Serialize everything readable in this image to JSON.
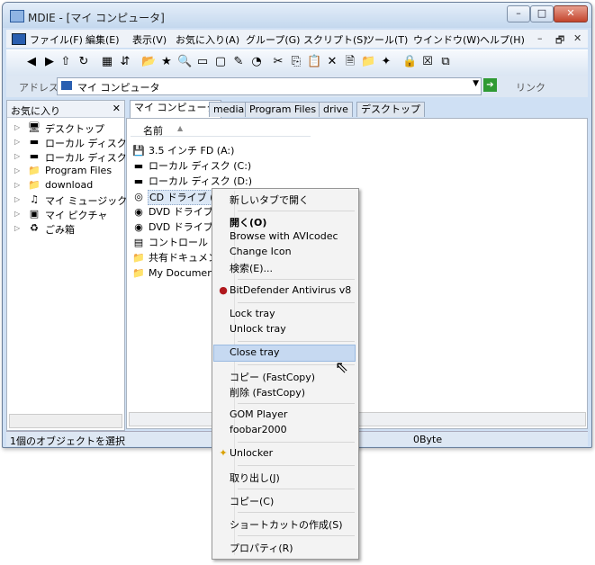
{
  "window": {
    "title": "MDIE - [マイ コンピュータ]",
    "controls": {
      "minimize": "–",
      "maximize": "□",
      "close": "✕"
    }
  },
  "menubar": {
    "items": [
      "ファイル(F)",
      "編集(E)",
      "表示(V)",
      "お気に入り(A)",
      "グループ(G)",
      "スクリプト(S)",
      "ツール(T)",
      "ウインドウ(W)",
      "ヘルプ(H)"
    ],
    "mdi_controls": {
      "minimize": "–",
      "restore": "🗗",
      "close": "✕"
    }
  },
  "toolbar": {
    "buttons": [
      {
        "name": "back",
        "glyph": "◀"
      },
      {
        "name": "forward",
        "glyph": "▶"
      },
      {
        "name": "up",
        "glyph": "⇧"
      },
      {
        "name": "refresh",
        "glyph": "↻"
      },
      {
        "name": "views",
        "glyph": "▦"
      },
      {
        "name": "sort",
        "glyph": "⇵"
      },
      {
        "name": "folder",
        "glyph": "📂"
      },
      {
        "name": "favorite",
        "glyph": "★"
      },
      {
        "name": "search",
        "glyph": "🔍"
      },
      {
        "name": "screen",
        "glyph": "▭"
      },
      {
        "name": "window",
        "glyph": "▢"
      },
      {
        "name": "edit",
        "glyph": "✎"
      },
      {
        "name": "history",
        "glyph": "◔"
      },
      {
        "name": "cut",
        "glyph": "✂"
      },
      {
        "name": "copy",
        "glyph": "⎘"
      },
      {
        "name": "paste",
        "glyph": "📋"
      },
      {
        "name": "delete",
        "glyph": "✕"
      },
      {
        "name": "properties",
        "glyph": "🗎"
      },
      {
        "name": "newfolder",
        "glyph": "📁"
      },
      {
        "name": "star",
        "glyph": "✦"
      },
      {
        "name": "lock",
        "glyph": "🔒"
      },
      {
        "name": "close-tab",
        "glyph": "☒"
      },
      {
        "name": "close-all",
        "glyph": "⧉"
      }
    ]
  },
  "addressbar": {
    "label": "アドレス",
    "value": "マイ コンピュータ",
    "links_label": "リンク"
  },
  "favorites": {
    "title": "お気に入り",
    "close": "✕",
    "items": [
      {
        "label": "デスクトップ",
        "icon": "desktop-icon",
        "glyph": "🖥"
      },
      {
        "label": "ローカル ディスク(",
        "icon": "drive-icon",
        "glyph": "▬"
      },
      {
        "label": "ローカル ディスク(",
        "icon": "drive-icon",
        "glyph": "▬"
      },
      {
        "label": "Program Files",
        "icon": "folder-icon",
        "glyph": "📁"
      },
      {
        "label": "download",
        "icon": "folder-icon",
        "glyph": "📁"
      },
      {
        "label": "マイ ミュージック",
        "icon": "music-folder-icon",
        "glyph": "♫"
      },
      {
        "label": "マイ ピクチャ",
        "icon": "pictures-folder-icon",
        "glyph": "▣"
      },
      {
        "label": "ごみ箱",
        "icon": "recycle-bin-icon",
        "glyph": "♻"
      }
    ]
  },
  "tabs": [
    "マイ コンピュータ",
    "media",
    "Program Files",
    "drive",
    "デスクトップ"
  ],
  "listview": {
    "column": "名前",
    "items": [
      {
        "label": "3.5 インチ FD (A:)",
        "icon": "floppy-icon",
        "glyph": "💾"
      },
      {
        "label": "ローカル ディスク (C:)",
        "icon": "drive-icon",
        "glyph": "▬"
      },
      {
        "label": "ローカル ディスク (D:)",
        "icon": "drive-icon",
        "glyph": "▬"
      },
      {
        "label": "CD ドライブ (E:",
        "icon": "cd-drive-icon",
        "glyph": "◎"
      },
      {
        "label": "DVD ドライブ (C",
        "icon": "dvd-drive-icon",
        "glyph": "◉"
      },
      {
        "label": "DVD ドライブ (H",
        "icon": "dvd-drive-icon",
        "glyph": "◉"
      },
      {
        "label": "コントロール パ",
        "icon": "control-panel-icon",
        "glyph": "▤"
      },
      {
        "label": "共有ドキュメン",
        "icon": "folder-icon",
        "glyph": "📁"
      },
      {
        "label": "My Documents",
        "icon": "folder-icon",
        "glyph": "📁"
      }
    ]
  },
  "context_menu": {
    "items": [
      "新しいタブで開く",
      "開く(O)",
      "Browse with AVIcodec",
      "Change Icon",
      "検索(E)...",
      "BitDefender Antivirus v8",
      "Lock tray",
      "Unlock tray",
      "Close tray",
      "コピー (FastCopy)",
      "削除 (FastCopy)",
      "GOM Player",
      "foobar2000",
      "Unlocker",
      "取り出し(J)",
      "コピー(C)",
      "ショートカットの作成(S)",
      "プロパティ(R)"
    ]
  },
  "statusbar": {
    "left": "1個のオブジェクトを選択",
    "right": "0Byte"
  }
}
